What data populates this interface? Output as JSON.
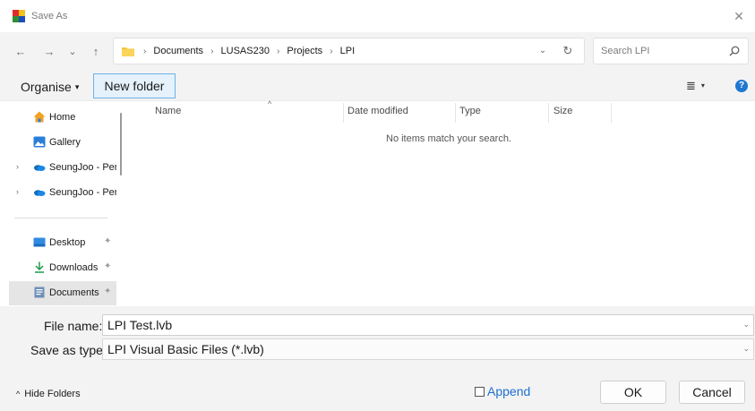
{
  "window": {
    "title": "Save As",
    "close_glyph": "✕",
    "app_icon": "lusas-app-icon"
  },
  "nav": {
    "back_glyph": "←",
    "forward_glyph": "→",
    "recent_glyph": "⌄",
    "up_glyph": "↑",
    "breadcrumb": [
      "Documents",
      "LUSAS230",
      "Projects",
      "LPI"
    ],
    "separator": "›",
    "dropdown_glyph": "⌄",
    "refresh_glyph": "↻",
    "search_placeholder": "Search LPI"
  },
  "commands": {
    "organise_label": "Organise",
    "caret": "▾",
    "new_folder_label": "New folder",
    "view_glyph": "≣",
    "help_glyph": "?"
  },
  "sidebar": {
    "items": [
      {
        "label": "Home",
        "icon": "home-icon",
        "chevron": ""
      },
      {
        "label": "Gallery",
        "icon": "gallery-icon",
        "chevron": ""
      },
      {
        "label": "SeungJoo - Pers",
        "icon": "onedrive-cloud-icon",
        "chevron": "›"
      },
      {
        "label": "SeungJoo - Pers",
        "icon": "onedrive-cloud-icon",
        "chevron": "›"
      },
      {
        "label": "Desktop",
        "icon": "desktop-icon",
        "pin": "✦"
      },
      {
        "label": "Downloads",
        "icon": "download-icon",
        "pin": "✦"
      },
      {
        "label": "Documents",
        "icon": "documents-icon",
        "pin": "✦",
        "selected": true
      }
    ]
  },
  "filelist": {
    "columns": [
      "Name",
      "Date modified",
      "Type",
      "Size"
    ],
    "sort_glyph": "^",
    "empty_message": "No items match your search."
  },
  "form": {
    "file_name_label": "File name:",
    "file_name_value": "LPI Test.lvb",
    "save_type_label": "Save as type:",
    "save_type_value": "LPI Visual Basic Files (*.lvb)",
    "dropdown_glyph": "⌄"
  },
  "footer": {
    "hide_folders_caret": "^",
    "hide_folders_label": "Hide Folders",
    "append_label": "Append",
    "append_checked": false,
    "ok_label": "OK",
    "cancel_label": "Cancel"
  },
  "colors": {
    "accent": "#1e78d2",
    "selection": "#e5f1fb",
    "selection_border": "#6fb1e6",
    "link": "#1f6fd0"
  }
}
